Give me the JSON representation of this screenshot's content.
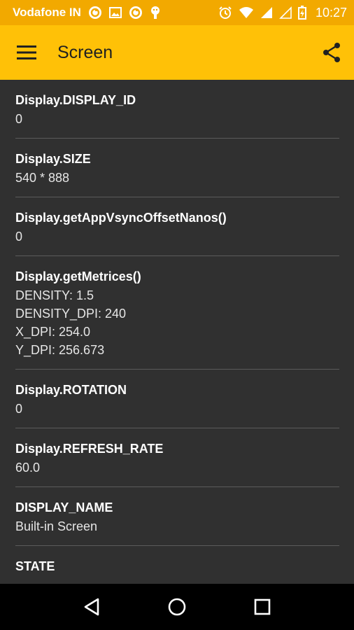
{
  "status_bar": {
    "carrier": "Vodafone IN",
    "time": "10:27",
    "icons": [
      "sync-icon",
      "image-icon",
      "sync-icon",
      "android-icon",
      "alarm-icon",
      "wifi-icon",
      "signal-icon",
      "signal-empty-icon",
      "battery-charging-icon"
    ]
  },
  "toolbar": {
    "title": "Screen",
    "menu_icon": "menu-icon",
    "share_icon": "share-icon"
  },
  "items": [
    {
      "label": "Display.DISPLAY_ID",
      "value": "0"
    },
    {
      "label": "Display.SIZE",
      "value": "540 * 888"
    },
    {
      "label": "Display.getAppVsyncOffsetNanos()",
      "value": "0"
    },
    {
      "label": "Display.getMetrices()",
      "value": "DENSITY: 1.5\nDENSITY_DPI: 240\nX_DPI: 254.0\nY_DPI: 256.673"
    },
    {
      "label": "Display.ROTATION",
      "value": "0"
    },
    {
      "label": "Display.REFRESH_RATE",
      "value": "60.0"
    },
    {
      "label": "DISPLAY_NAME",
      "value": "Built-in Screen"
    },
    {
      "label": "STATE",
      "value": ""
    }
  ],
  "colors": {
    "status_bar": "#f2a900",
    "toolbar": "#ffc107",
    "background": "#303030",
    "divider": "#5b5b5b"
  }
}
